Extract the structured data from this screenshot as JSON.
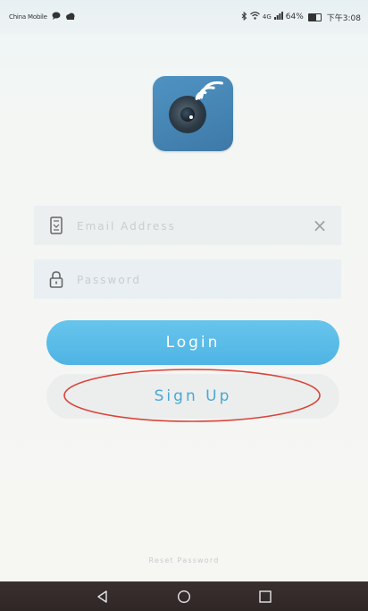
{
  "status_bar": {
    "carrier": "China Mobile",
    "left_icons": [
      "chat-icon",
      "cloud-icon"
    ],
    "right_icons": [
      "bluetooth-icon",
      "wifi-icon",
      "signal-icon"
    ],
    "signal_text": "4G",
    "battery_percent": "64%",
    "battery_level": 0.64,
    "time": "下午3:08"
  },
  "app": {
    "logo_icon": "camera-lens-icon"
  },
  "login_form": {
    "email": {
      "icon": "phone-icon",
      "placeholder": "Email Address",
      "value": "",
      "clear_icon": "close-icon",
      "clear_glyph": "×"
    },
    "password": {
      "icon": "lock-icon",
      "placeholder": "Password",
      "value": ""
    },
    "login_label": "Login",
    "signup_label": "Sign Up"
  },
  "footer": {
    "reset_label": "Reset Password"
  },
  "annotation": {
    "color": "#d9433a",
    "target": "Sign Up"
  },
  "colors": {
    "login_button": "#5bbde8",
    "signup_text": "#4aa8d4",
    "nav_bar": "#332a2a"
  },
  "navigation_bar": {
    "buttons": [
      "back-icon",
      "home-icon",
      "recents-icon"
    ]
  }
}
